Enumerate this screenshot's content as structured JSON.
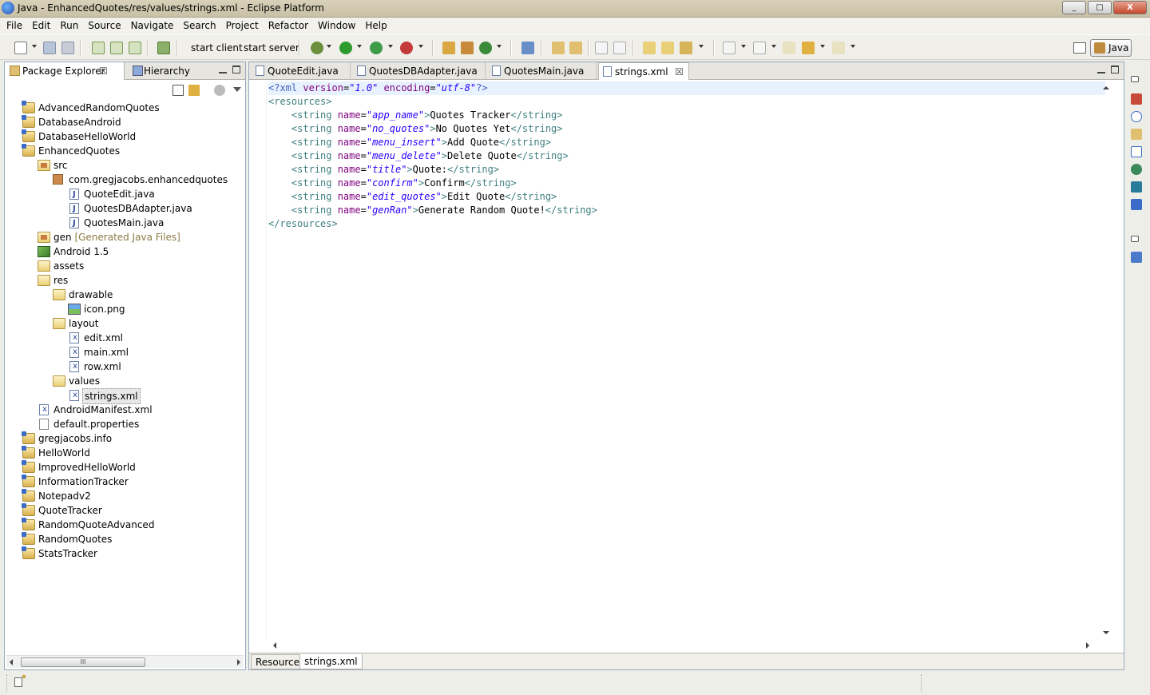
{
  "window": {
    "title": "Java - EnhancedQuotes/res/values/strings.xml - Eclipse Platform",
    "controls": [
      "_",
      "□",
      "X"
    ]
  },
  "menubar": [
    "File",
    "Edit",
    "Run",
    "Source",
    "Navigate",
    "Search",
    "Project",
    "Refactor",
    "Window",
    "Help"
  ],
  "toolbar": {
    "start_client": "start client",
    "start_server": "start server",
    "perspective": "Java"
  },
  "left_view": {
    "tabs": [
      {
        "label": "Package Explorer",
        "active": true
      },
      {
        "label": "Hierarchy",
        "active": false
      }
    ],
    "tree": [
      {
        "label": "AdvancedRandomQuotes",
        "depth": 0,
        "icon": "project-icon"
      },
      {
        "label": "DatabaseAndroid",
        "depth": 0,
        "icon": "project-icon"
      },
      {
        "label": "DatabaseHelloWorld",
        "depth": 0,
        "icon": "project-icon"
      },
      {
        "label": "EnhancedQuotes",
        "depth": 0,
        "icon": "project-icon"
      },
      {
        "label": "src",
        "depth": 1,
        "icon": "source-folder-icon"
      },
      {
        "label": "com.gregjacobs.enhancedquotes",
        "depth": 2,
        "icon": "package-icon"
      },
      {
        "label": "QuoteEdit.java",
        "depth": 3,
        "icon": "java-file-icon"
      },
      {
        "label": "QuotesDBAdapter.java",
        "depth": 3,
        "icon": "java-file-icon"
      },
      {
        "label": "QuotesMain.java",
        "depth": 3,
        "icon": "java-file-icon"
      },
      {
        "label": "gen",
        "suffix": "[Generated Java Files]",
        "depth": 1,
        "icon": "source-folder-icon"
      },
      {
        "label": "Android 1.5",
        "depth": 1,
        "icon": "library-icon"
      },
      {
        "label": "assets",
        "depth": 1,
        "icon": "folder-icon"
      },
      {
        "label": "res",
        "depth": 1,
        "icon": "folder-icon"
      },
      {
        "label": "drawable",
        "depth": 2,
        "icon": "folder-icon"
      },
      {
        "label": "icon.png",
        "depth": 3,
        "icon": "image-file-icon"
      },
      {
        "label": "layout",
        "depth": 2,
        "icon": "folder-icon"
      },
      {
        "label": "edit.xml",
        "depth": 3,
        "icon": "xml-file-icon"
      },
      {
        "label": "main.xml",
        "depth": 3,
        "icon": "xml-file-icon"
      },
      {
        "label": "row.xml",
        "depth": 3,
        "icon": "xml-file-icon"
      },
      {
        "label": "values",
        "depth": 2,
        "icon": "folder-icon"
      },
      {
        "label": "strings.xml",
        "depth": 3,
        "icon": "xml-file-icon",
        "selected": true
      },
      {
        "label": "AndroidManifest.xml",
        "depth": 1,
        "icon": "xml-file-icon"
      },
      {
        "label": "default.properties",
        "depth": 1,
        "icon": "file-icon"
      },
      {
        "label": "gregjacobs.info",
        "depth": 0,
        "icon": "project-icon"
      },
      {
        "label": "HelloWorld",
        "depth": 0,
        "icon": "project-icon"
      },
      {
        "label": "ImprovedHelloWorld",
        "depth": 0,
        "icon": "project-icon"
      },
      {
        "label": "InformationTracker",
        "depth": 0,
        "icon": "project-icon"
      },
      {
        "label": "Notepadv2",
        "depth": 0,
        "icon": "project-icon"
      },
      {
        "label": "QuoteTracker",
        "depth": 0,
        "icon": "project-icon"
      },
      {
        "label": "RandomQuoteAdvanced",
        "depth": 0,
        "icon": "project-icon"
      },
      {
        "label": "RandomQuotes",
        "depth": 0,
        "icon": "project-icon"
      },
      {
        "label": "StatsTracker",
        "depth": 0,
        "icon": "project-icon"
      }
    ],
    "hscroll_thumb": "III"
  },
  "editor": {
    "tabs": [
      {
        "label": "QuoteEdit.java",
        "active": false
      },
      {
        "label": "QuotesDBAdapter.java",
        "active": false
      },
      {
        "label": "QuotesMain.java",
        "active": false
      },
      {
        "label": "strings.xml",
        "active": true
      }
    ],
    "code": {
      "declaration": {
        "open": "<?xml ",
        "a1": "version",
        "v1": "\"1.0\"",
        "a2": "encoding",
        "v2": "\"utf-8\"",
        "close": "?>"
      },
      "root_open": "<resources>",
      "root_close": "</resources>",
      "strings": [
        {
          "name": "\"app_name\"",
          "text": "Quotes Tracker"
        },
        {
          "name": "\"no_quotes\"",
          "text": "No Quotes Yet"
        },
        {
          "name": "\"menu_insert\"",
          "text": "Add Quote"
        },
        {
          "name": "\"menu_delete\"",
          "text": "Delete Quote"
        },
        {
          "name": "\"title\"",
          "text": "Quote:"
        },
        {
          "name": "\"confirm\"",
          "text": "Confirm"
        },
        {
          "name": "\"edit_quotes\"",
          "text": "Edit Quote"
        },
        {
          "name": "\"genRan\"",
          "text": "Generate Random Quote!"
        }
      ]
    },
    "bottom_tabs": [
      {
        "label": "Resources",
        "active": false
      },
      {
        "label": "strings.xml",
        "active": true
      }
    ]
  },
  "colors": {
    "tag": "#3f7f7f",
    "attribute": "#7f007f",
    "value": "#2a00ff",
    "current_line": "#e8f2fe"
  }
}
